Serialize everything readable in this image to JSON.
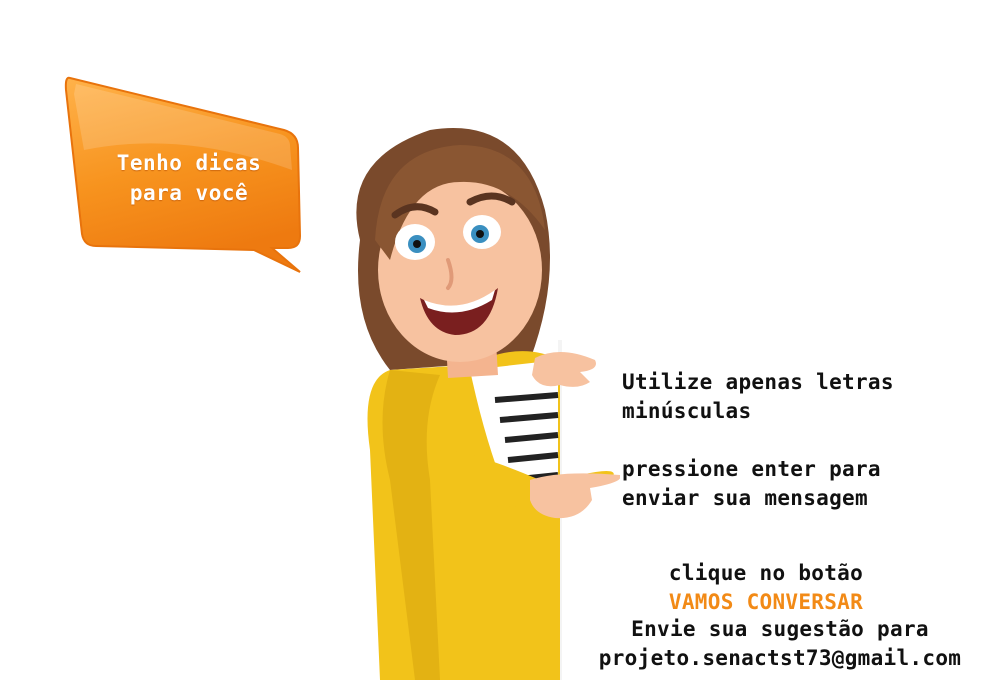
{
  "speech_bubble": {
    "text": "Tenho dicas\npara você",
    "color": "#f7931e"
  },
  "tips": {
    "tip_1": "Utilize apenas letras\nminúsculas",
    "tip_2": "pressione enter para\nenviar sua mensagem",
    "tip_3_line_1": "clique no botão",
    "tip_3_button_name": "VAMOS CONVERSAR",
    "tip_4": "Envie sua sugestão para\nprojeto.senactst73@gmail.com"
  },
  "colors": {
    "accent": "#f28a16",
    "text": "#111111",
    "coat": "#f2c31a"
  },
  "illustration": {
    "subject": "cartoon-woman-pointing-icon"
  }
}
